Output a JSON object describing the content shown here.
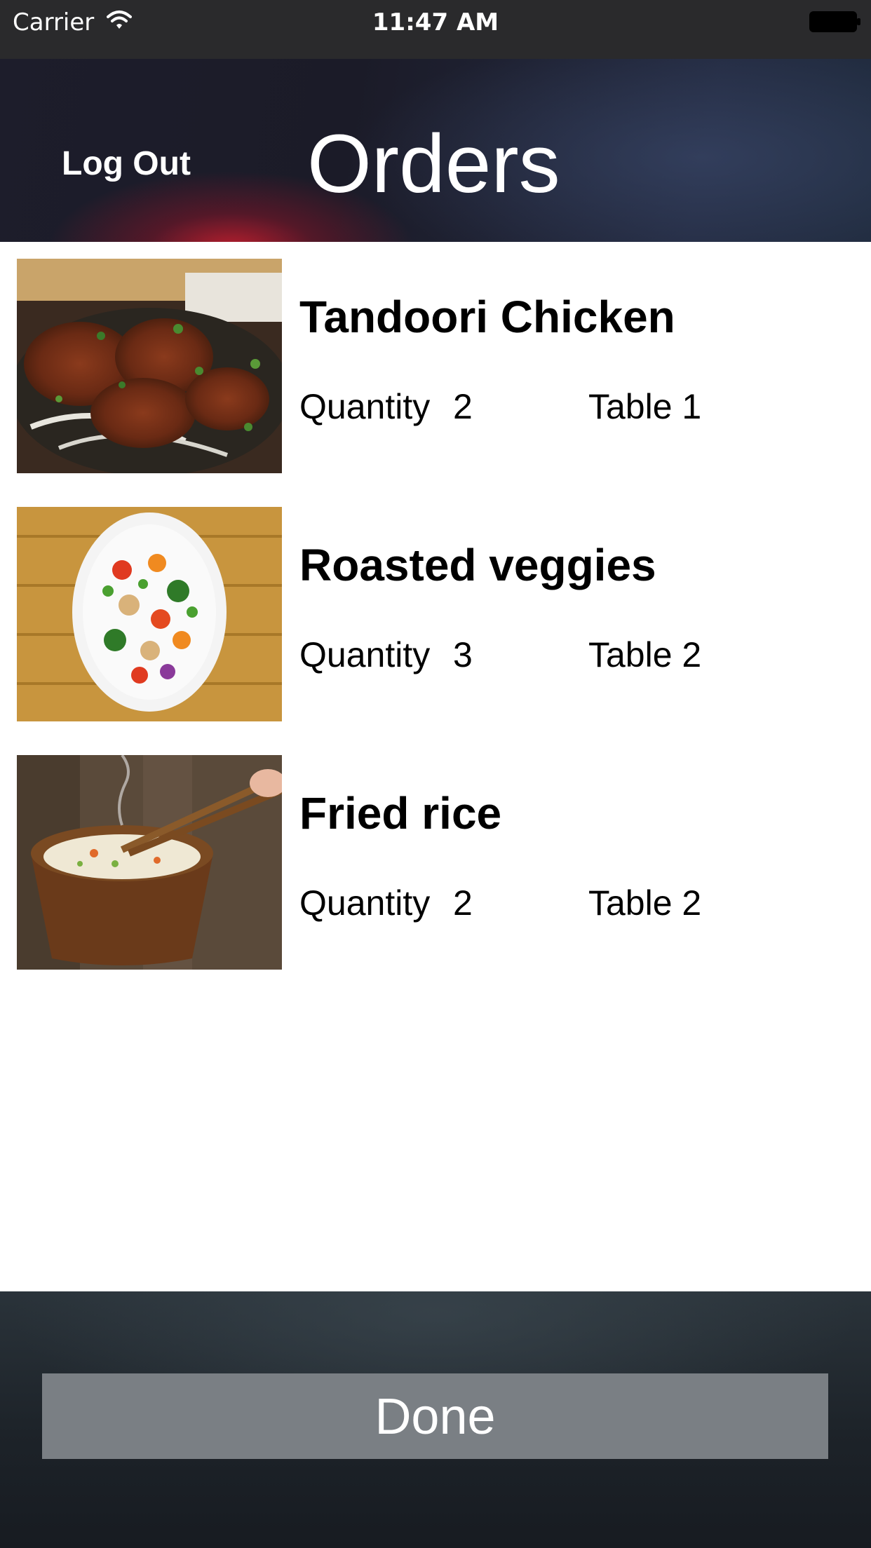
{
  "status_bar": {
    "carrier": "Carrier",
    "time": "11:47 AM",
    "wifi_icon": "wifi-icon",
    "battery_icon": "battery-icon"
  },
  "header": {
    "logout_label": "Log Out",
    "title": "Orders"
  },
  "orders": [
    {
      "name": "Tandoori Chicken",
      "quantity_label": "Quantity",
      "quantity": "2",
      "table": "Table 1",
      "image": "tandoori-chicken-photo"
    },
    {
      "name": "Roasted veggies",
      "quantity_label": "Quantity",
      "quantity": "3",
      "table": "Table 2",
      "image": "roasted-veggies-photo"
    },
    {
      "name": "Fried rice",
      "quantity_label": "Quantity",
      "quantity": "2",
      "table": "Table 2",
      "image": "fried-rice-photo"
    }
  ],
  "footer": {
    "done_label": "Done"
  },
  "colors": {
    "status_bar_bg": "#2a2a2c",
    "done_button_bg": "#7a7f84",
    "accent_red": "#be1e2d"
  }
}
